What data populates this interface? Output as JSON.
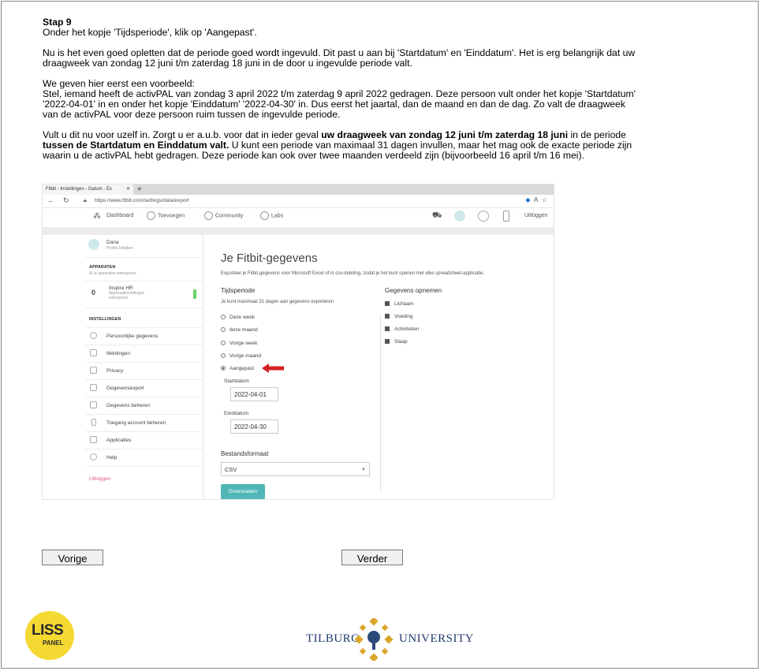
{
  "instructions": {
    "step_title": "Stap 9",
    "p1": "Onder het kopje 'Tijdsperiode', klik op 'Aangepast'.",
    "p2": "Nu is het even goed opletten dat de periode goed wordt ingevuld. Dit past u aan bij 'Startdatum' en 'Einddatum'. Het is erg belangrijk dat uw draagweek van zondag 12 juni t/m zaterdag 18 juni in de door u ingevulde periode valt.",
    "p3_line1": "We geven hier eerst een voorbeeld:",
    "p3_rest": "Stel, iemand heeft de activPAL van zondag 3 april 2022 t/m zaterdag 9 april 2022 gedragen. Deze persoon vult onder het kopje 'Startdatum' '2022-04-01' in en onder het kopje 'Einddatum' '2022-04-30' in. Dus eerst het jaartal, dan de maand en dan de dag. Zo valt de draagweek van de activPAL voor deze persoon ruim tussen de ingevulde periode.",
    "p4_a": "Vult u dit nu voor uzelf in. Zorgt u er a.u.b. voor dat in ieder geval ",
    "p4_b": "uw draagweek van zondag 12 juni t/m zaterdag 18 juni",
    "p4_c": " in de periode ",
    "p4_d": "tussen de Startdatum en Einddatum valt.",
    "p4_e": " U kunt een periode van maximaal 31 dagen invullen, maar het mag ook de exacte periode zijn waarin u de activPAL hebt gedragen. Deze periode kan ook over twee maanden verdeeld zijn (bijvoorbeeld 16 april t/m 16 mei)."
  },
  "screenshot": {
    "tab_title": "Fitbit - Instellingen - Datum - Ex",
    "url": "https://www.fitbit.com/settings/data/export",
    "nav": {
      "dashboard": "Dashboard",
      "add": "Toevoegen",
      "community": "Community",
      "labs": "Labs",
      "logout": "Uitloggen"
    },
    "sidebar": {
      "user_name": "Dana",
      "user_sub": "Profiel bekijken",
      "devices_header": "APPARATEN",
      "devices_sub": "Al je apparaten weergeven",
      "device_name": "Inspire HR",
      "device_sub": "Apparaatinstellingen weergeven",
      "settings_header": "INSTELLINGEN",
      "items": [
        "Persoonlijke gegevens",
        "Meldingen",
        "Privacy",
        "Gegevensexport",
        "Gegevens beheren",
        "Toegang account beheren",
        "Applicaties",
        "Help"
      ],
      "logout": "Uitloggen"
    },
    "main": {
      "title": "Je Fitbit-gegevens",
      "subtitle": "Exporteer je Fitbit-gegevens voor Microsoft Excel of in csv-indeling, zodat je het kunt openen met elke spreadsheet-applicatie.",
      "period_header": "Tijdsperiode",
      "period_note": "Je kunt maximaal 31 dagen aan gegevens exporteren",
      "options": [
        "Deze week",
        "deze maand",
        "Vorige week",
        "Vorige maand",
        "Aangepast"
      ],
      "selected_option": "Aangepast",
      "start_label": "Startdatum",
      "start_value": "2022-04-01",
      "end_label": "Einddatum",
      "end_value": "2022-04-30",
      "record_header": "Gegevens opnemen",
      "record_items": [
        "Lichaam",
        "Voeding",
        "Activiteiten",
        "Slaap"
      ],
      "format_header": "Bestandsformaat",
      "format_value": "CSV",
      "download": "Downloaden"
    }
  },
  "buttons": {
    "prev": "Vorige",
    "next": "Verder"
  },
  "logos": {
    "liss_top": "LISS",
    "liss_bottom": "PANEL",
    "tilburg_left": "TILBURG",
    "tilburg_right": "UNIVERSITY"
  },
  "colors": {
    "accent_teal": "#4fb8b7",
    "arrow_red": "#d42020",
    "liss_yellow": "#f5d933",
    "tilburg_gold": "#d9a72b",
    "tilburg_blue": "#1e3a6d"
  }
}
